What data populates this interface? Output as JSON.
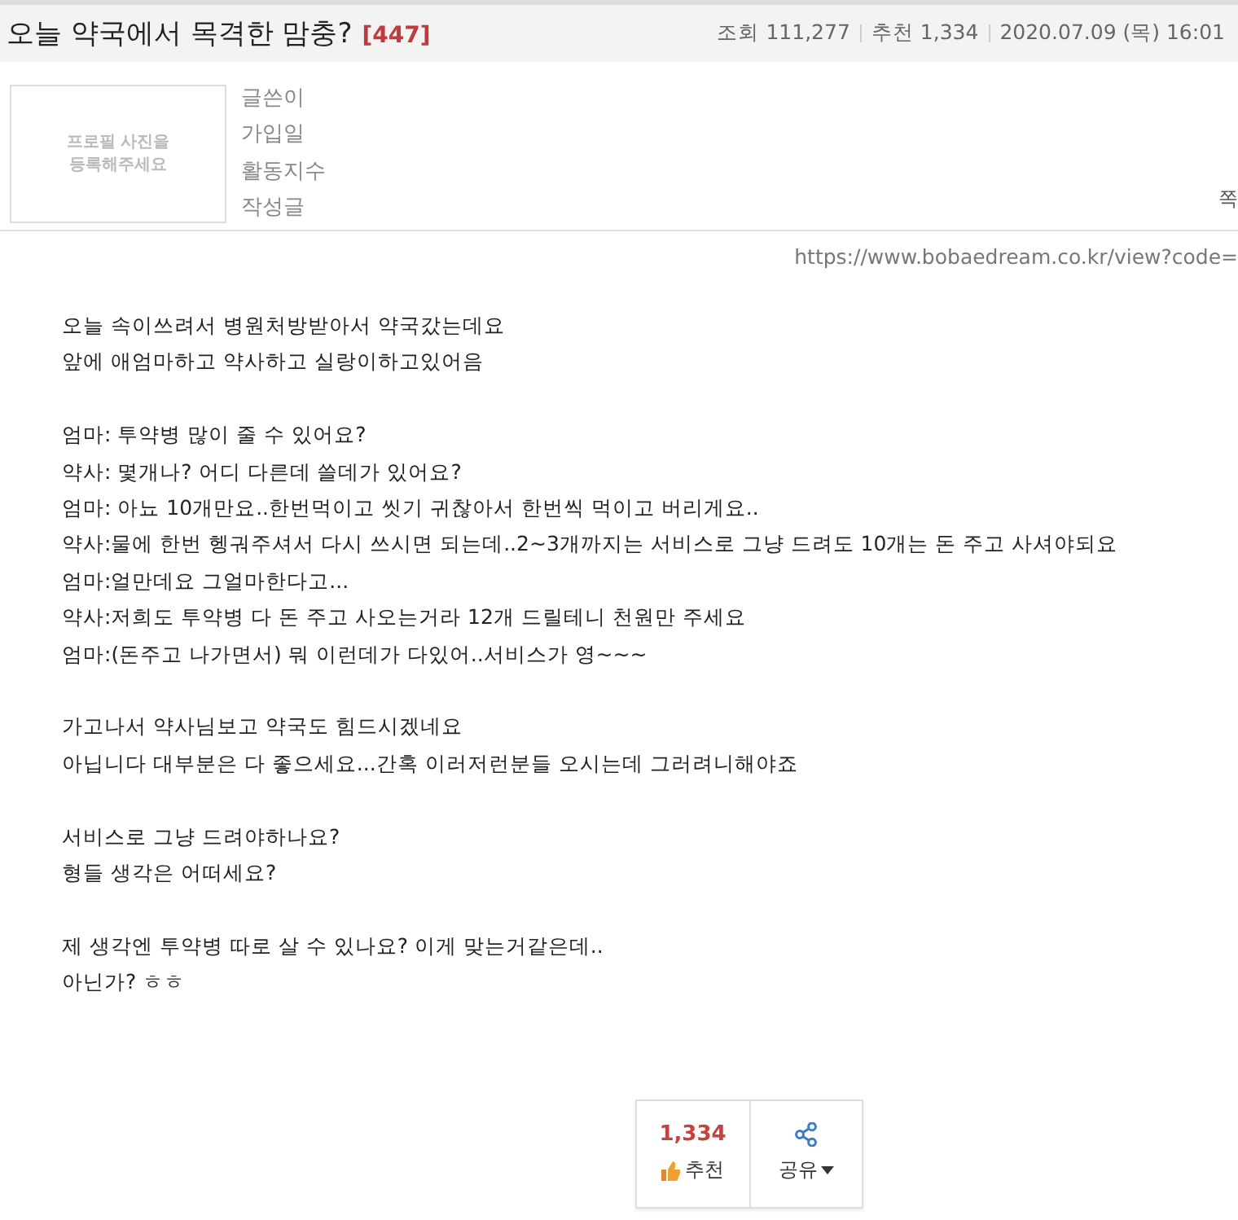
{
  "post": {
    "title": "오늘 약국에서 목격한 맘충?",
    "comment_count": "[447]",
    "meta": [
      {
        "label": "조회",
        "value": "111,277"
      },
      {
        "label": "추천",
        "value": "1,334"
      },
      {
        "value": "2020.07.09 (목) 16:01"
      }
    ]
  },
  "profile": {
    "photo_placeholder": "프로필 사진을 등록해주세요",
    "fields": [
      "글쓴이",
      "가입일",
      "활동지수",
      "작성글"
    ],
    "side_text": "쪽"
  },
  "source_url": "https://www.bobaedream.co.kr/view?code=",
  "body": [
    [
      "오늘 속이쓰려서 병원처방받아서 약국갔는데요",
      "앞에 애엄마하고 약사하고 실랑이하고있어음"
    ],
    [
      "엄마: 투약병 많이 줄 수 있어요?",
      "약사: 몇개나? 어디 다른데 쓸데가 있어요?",
      "엄마: 아뇨 10개만요..한번먹이고 씻기 귀찮아서 한번씩 먹이고 버리게요..",
      "약사:물에 한번 헹궈주셔서 다시 쓰시면 되는데..2~3개까지는 서비스로 그냥 드려도 10개는 돈 주고 사셔야되요",
      "엄마:얼만데요 그얼마한다고...",
      "약사:저희도 투약병 다 돈 주고 사오는거라 12개 드릴테니 천원만 주세요",
      "엄마:(돈주고 나가면서) 뭐 이런데가 다있어..서비스가 영~~~"
    ],
    [
      "가고나서 약사님보고 약국도 힘드시겠네요",
      "아닙니다 대부분은 다 좋으세요...간혹 이러저런분들 오시는데 그러려니해야죠"
    ],
    [
      "서비스로 그냥 드려야하나요?",
      "형들 생각은 어떠세요?"
    ],
    [
      "제 생각엔 투약병 따로 살 수 있나요? 이게 맞는거같은데..",
      "아닌가? ㅎㅎ"
    ]
  ],
  "actions": {
    "recommend_count": "1,334",
    "recommend_label": "추천",
    "share_label": "공유"
  }
}
